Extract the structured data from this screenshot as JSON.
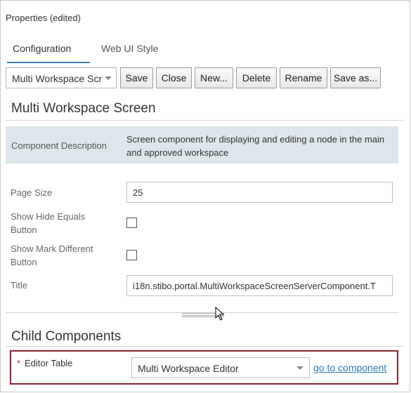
{
  "panel": {
    "title": "Properties (edited)"
  },
  "tabs": [
    {
      "label": "Configuration",
      "active": true
    },
    {
      "label": "Web UI Style",
      "active": false
    }
  ],
  "toolbar": {
    "selected_component": "Multi Workspace Scr",
    "buttons": [
      "Save",
      "Close",
      "New...",
      "Delete",
      "Rename",
      "Save as..."
    ]
  },
  "main": {
    "heading": "Multi Workspace Screen",
    "description": {
      "label": "Component Description",
      "text": "Screen component for displaying and editing a node in the main and approved workspace"
    },
    "fields": {
      "page_size": {
        "label": "Page Size",
        "value": "25"
      },
      "show_hide_equals": {
        "label_line1": "Show Hide Equals",
        "label_line2": "Button",
        "checked": false
      },
      "show_mark_different": {
        "label_line1": "Show Mark Different",
        "label_line2": "Button",
        "checked": false
      },
      "title": {
        "label": "Title",
        "value": "i18n.stibo.portal.MultiWorkspaceScreenServerComponent.T"
      }
    }
  },
  "child_components": {
    "heading": "Child Components",
    "editor_table": {
      "required_mark": "*",
      "label": "Editor Table",
      "selected": "Multi Workspace Editor",
      "link": "go to component"
    }
  },
  "colors": {
    "accent": "#3a7fc1",
    "description_bg": "#dde6ea",
    "required_border": "#8a2430",
    "link": "#2a7ab8"
  }
}
